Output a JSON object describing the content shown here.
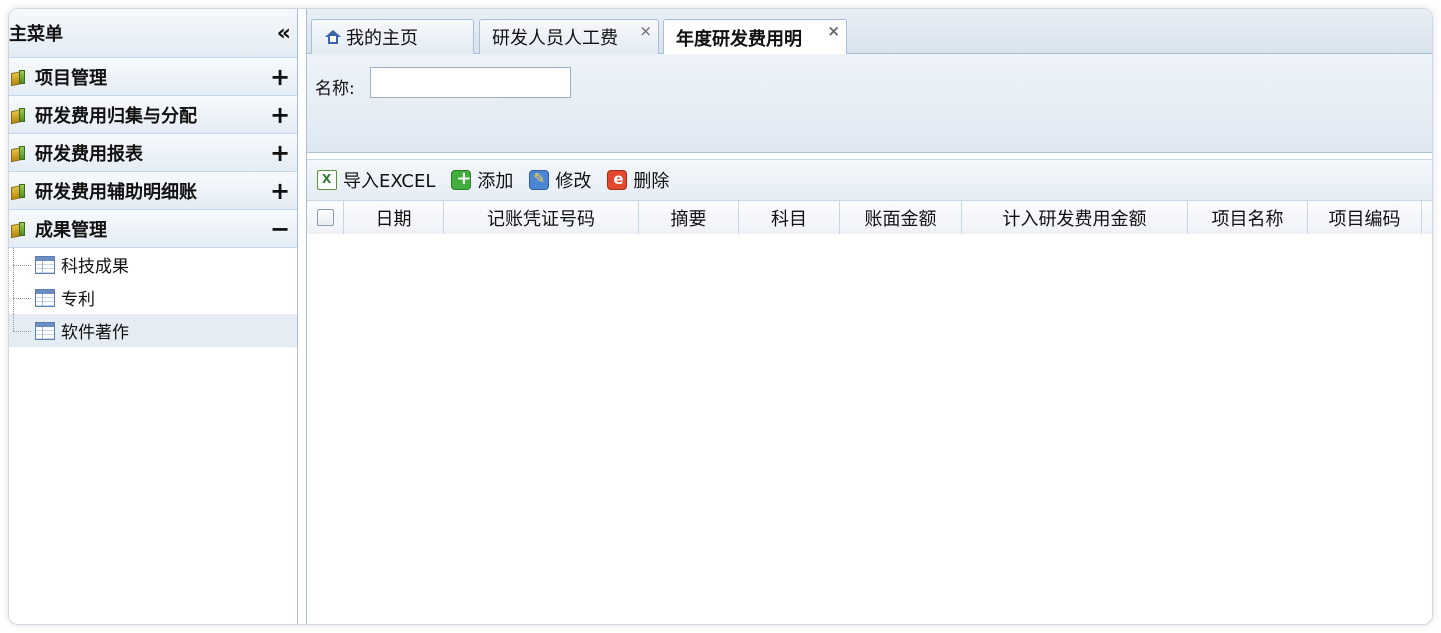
{
  "sidebar": {
    "title": "主菜单",
    "collapse_glyph": "«",
    "groups": [
      {
        "label": "项目管理",
        "toggle": "+"
      },
      {
        "label": "研发费用归集与分配",
        "toggle": "+"
      },
      {
        "label": "研发费用报表",
        "toggle": "+"
      },
      {
        "label": "研发费用辅助明细账",
        "toggle": "+"
      },
      {
        "label": "成果管理",
        "toggle": "−"
      }
    ],
    "subitems": [
      {
        "label": "科技成果"
      },
      {
        "label": "专利"
      },
      {
        "label": "软件著作",
        "selected": true
      }
    ]
  },
  "tabs": [
    {
      "label": "我的主页",
      "icon": "home-icon"
    },
    {
      "label": "研发人员人工费",
      "close": "×"
    },
    {
      "label": "年度研发费用明",
      "close": "×",
      "active": true
    }
  ],
  "search": {
    "name_label": "名称:",
    "name_value": "",
    "name_placeholder": ""
  },
  "toolbar": {
    "import_label": "导入EXCEL",
    "add_label": "添加",
    "edit_label": "修改",
    "delete_label": "删除"
  },
  "grid": {
    "columns": [
      "日期",
      "记账凭证号码",
      "摘要",
      "科目",
      "账面金额",
      "计入研发费用金额",
      "项目名称",
      "项目编码"
    ],
    "rows": []
  },
  "colors": {
    "border": "#a9c1d8",
    "header_bg": "#dfe8f2",
    "selected_bg": "#e6ecf3"
  }
}
